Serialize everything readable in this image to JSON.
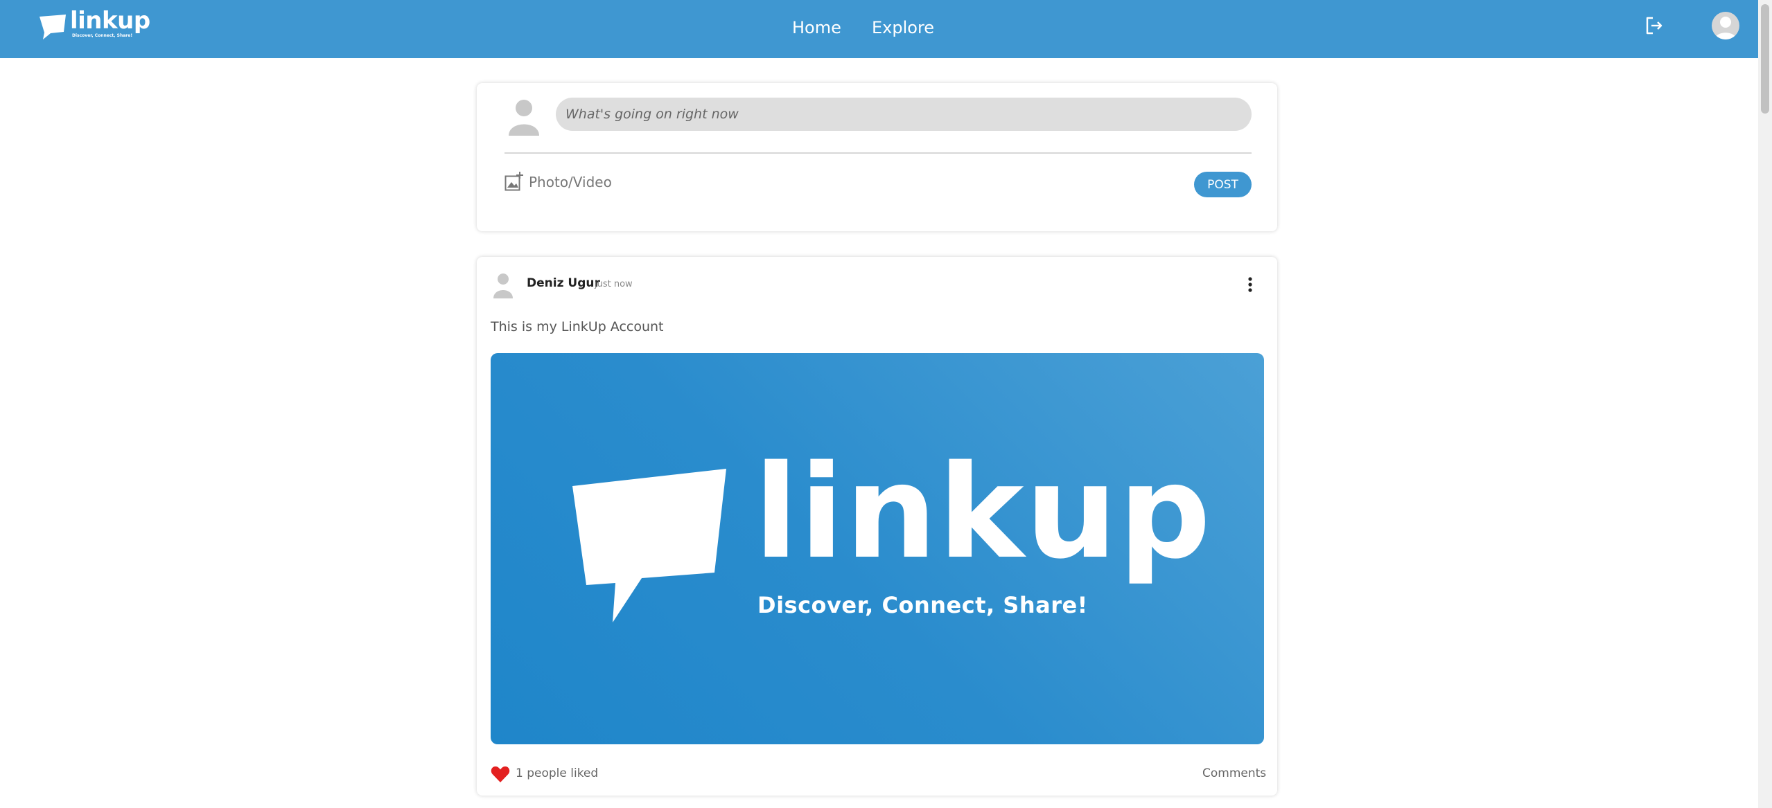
{
  "header": {
    "logo_text": "linkup",
    "logo_tagline": "Discover, Connect, Share!",
    "nav": [
      {
        "label": "Home"
      },
      {
        "label": "Explore"
      }
    ],
    "icons": {
      "logout": "logout-icon",
      "profile": "avatar-icon"
    },
    "bg_color": "#3f97d1"
  },
  "composer": {
    "placeholder": "What's going on right now",
    "photo_label": "Photo/Video",
    "post_label": "POST"
  },
  "post": {
    "author": "Deniz Ugur",
    "time": "just now",
    "text": "This is my LinkUp Account",
    "image": {
      "word": "linkup",
      "tagline": "Discover, Connect, Share!"
    },
    "likes_text": "1 people liked",
    "comments_label": "Comments",
    "like_color": "#e32020"
  }
}
